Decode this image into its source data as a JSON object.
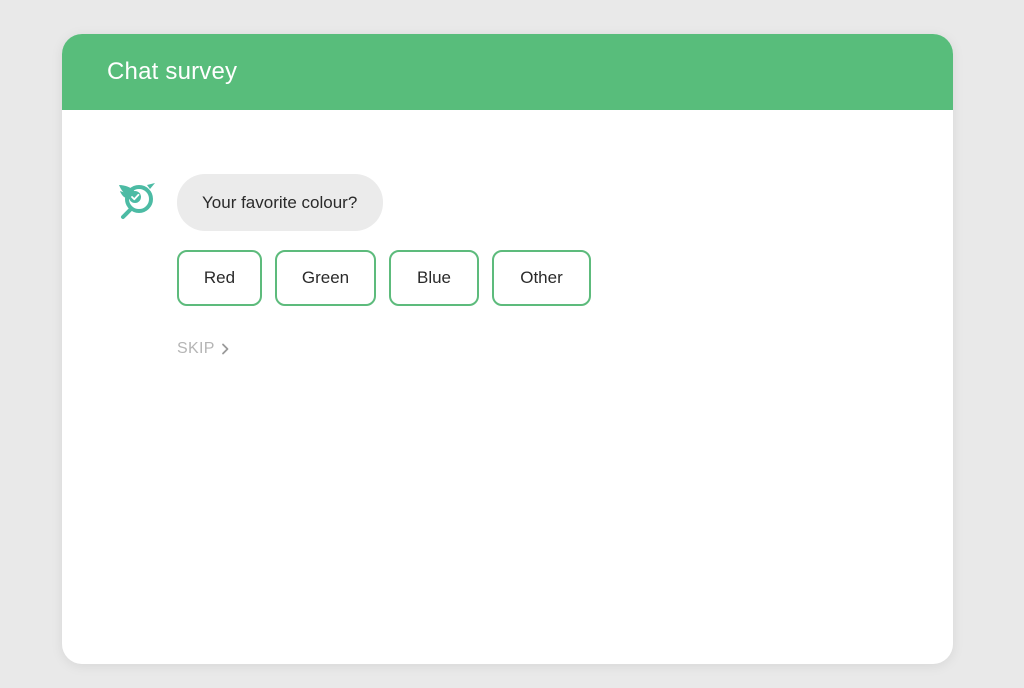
{
  "colors": {
    "brand": "#58bd7b",
    "accent_bot": "#4cbba4",
    "option_border": "#5dbb7c",
    "bubble_bg": "#ebebeb",
    "skip_text": "#b5b5b5"
  },
  "header": {
    "title": "Chat survey"
  },
  "chat": {
    "avatar_icon": "bird-check-icon",
    "question": "Your favorite colour?",
    "options": [
      {
        "label": "Red"
      },
      {
        "label": "Green"
      },
      {
        "label": "Blue"
      },
      {
        "label": "Other"
      }
    ],
    "skip_label": "SKIP",
    "skip_icon": "chevron-right-icon"
  }
}
